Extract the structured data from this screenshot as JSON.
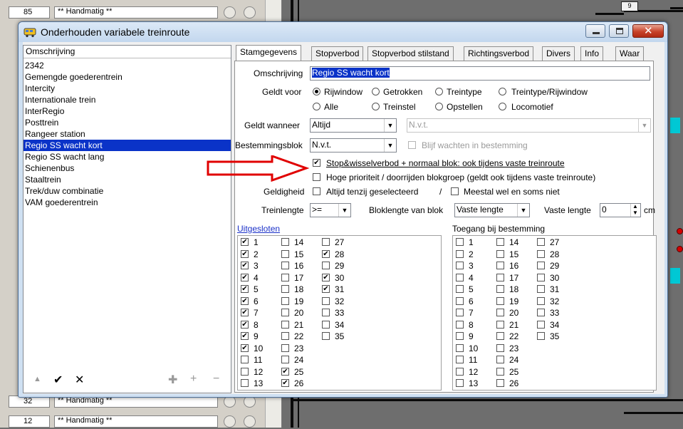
{
  "background": {
    "rows_top": [
      {
        "num": "85",
        "text": "** Handmatig **"
      }
    ],
    "rows_bottom": [
      {
        "num": "32",
        "text": "** Handmatig **"
      },
      {
        "num": "12",
        "text": "** Handmatig **"
      }
    ],
    "badge": "9"
  },
  "window": {
    "title": "Onderhouden variabele treinroute"
  },
  "list": {
    "header": "Omschrijving",
    "items": [
      "2342",
      "Gemengde goederentrein",
      "Intercity",
      "Internationale trein",
      "InterRegio",
      "Posttrein",
      "Rangeer station",
      "Regio SS wacht kort",
      "Regio SS wacht lang",
      "Schienenbus",
      "Staaltrein",
      "Trek/duw combinatie",
      "VAM goederentrein"
    ],
    "selected_index": 7
  },
  "toolbar": {
    "up": "▲",
    "ok": "✔",
    "delete": "✕",
    "add_many": "✚",
    "add": "+",
    "remove": "−"
  },
  "tabs": [
    "Stamgegevens",
    "Stopverbod",
    "Stopverbod stilstand",
    "Richtingsverbod",
    "Divers",
    "Info",
    "Waar"
  ],
  "form": {
    "omschrijving_label": "Omschrijving",
    "omschrijving_value": "Regio SS wacht kort",
    "geldt_voor_label": "Geldt voor",
    "geldt_voor_options": [
      "Rijwindow",
      "Getrokken",
      "Treintype",
      "Treintype/Rijwindow",
      "Alle",
      "Treinstel",
      "Opstellen",
      "Locomotief"
    ],
    "geldt_voor_selected": "Rijwindow",
    "geldt_wanneer_label": "Geldt wanneer",
    "geldt_wanneer_value": "Altijd",
    "geldt_wanneer_extra": "N.v.t.",
    "bestemmingsblok_label": "Bestemmingsblok",
    "bestemmingsblok_value": "N.v.t.",
    "blijf_label": "Blijf wachten in bestemming",
    "stop_label": "Stop&wisselverbod + normaal blok: ook tijdens vaste treinroute",
    "stop_checked": true,
    "hoge_label": "Hoge prioriteit / doorrijden blokgroep (geldt ook tijdens vaste treinroute)",
    "geldigheid_label": "Geldigheid",
    "geldigheid_opt1": "Altijd tenzij geselecteerd",
    "geldigheid_sep": "/",
    "geldigheid_opt2": "Meestal wel en soms niet",
    "treinlengte_label": "Treinlengte",
    "treinlengte_value": ">=",
    "bloklengte_label": "Bloklengte van blok",
    "bloklengte_value": "Vaste lengte",
    "vaste_lengte_label": "Vaste lengte",
    "vaste_lengte_value": "0",
    "unit": "cm"
  },
  "uitgesloten": {
    "title": "Uitgesloten",
    "numbers": [
      "1",
      "2",
      "3",
      "4",
      "5",
      "6",
      "7",
      "8",
      "9",
      "10",
      "11",
      "12",
      "13",
      "14",
      "15",
      "16",
      "17",
      "18",
      "19",
      "20",
      "21",
      "22",
      "23",
      "24",
      "25",
      "26",
      "27",
      "28",
      "29",
      "30",
      "31",
      "32",
      "33",
      "34",
      "35"
    ],
    "checked": [
      "1",
      "2",
      "3",
      "4",
      "5",
      "6",
      "7",
      "8",
      "9",
      "10",
      "25",
      "26",
      "28",
      "30",
      "31"
    ]
  },
  "toegang": {
    "title": "Toegang bij bestemming",
    "numbers": [
      "1",
      "2",
      "3",
      "4",
      "5",
      "6",
      "7",
      "8",
      "9",
      "10",
      "11",
      "12",
      "13",
      "14",
      "15",
      "16",
      "17",
      "18",
      "19",
      "20",
      "21",
      "22",
      "23",
      "24",
      "25",
      "26",
      "27",
      "28",
      "29",
      "30",
      "31",
      "32",
      "33",
      "34",
      "35"
    ],
    "checked": []
  },
  "colors": {
    "selection": "#0a33c8",
    "arrow": "#e00000",
    "window_frame": "#cfe0f2"
  }
}
